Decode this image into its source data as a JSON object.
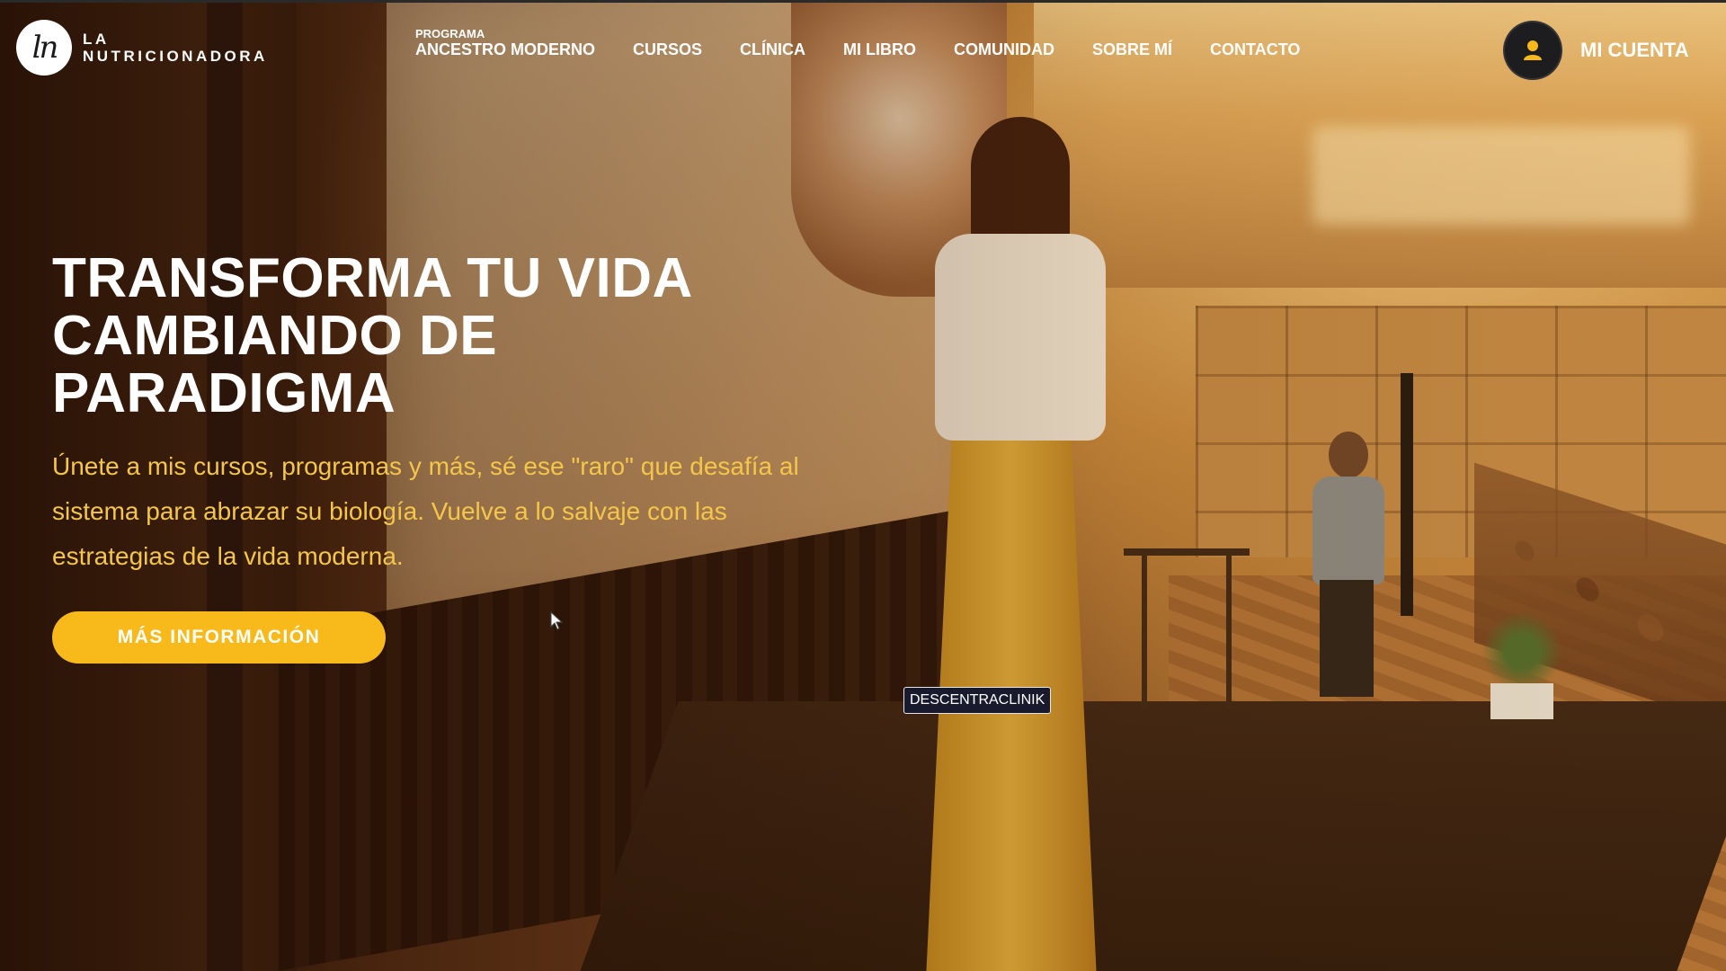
{
  "header": {
    "logo": {
      "line1": "LA",
      "line2": "NUTRICIONADORA",
      "mark": "ln"
    },
    "nav": [
      {
        "sup": "PROGRAMA",
        "label": "ANCESTRO MODERNO"
      },
      {
        "label": "CURSOS"
      },
      {
        "label": "CLÍNICA"
      },
      {
        "label": "MI LIBRO"
      },
      {
        "label": "COMUNIDAD"
      },
      {
        "label": "SOBRE MÍ"
      },
      {
        "label": "CONTACTO"
      }
    ],
    "account": {
      "label": "MI CUENTA",
      "icon": "user-icon"
    }
  },
  "hero": {
    "title_lines": [
      "TRANSFORMA TU VIDA",
      "CAMBIANDO DE",
      "PARADIGMA"
    ],
    "subtitle_lines": [
      "Únete a mis cursos, programas y más, sé ese \"raro\" que desafía al",
      "sistema para abrazar su biología. Vuelve a lo salvaje con las",
      "estrategias de la vida moderna."
    ],
    "cta_label": "MÁS INFORMACIÓN"
  },
  "tooltip": {
    "text": "DESCENTRACLINIK"
  },
  "colors": {
    "accent": "#f8b91a",
    "subtitle": "#f4c64a",
    "avatar_bg": "#1d1d1f",
    "avatar_icon": "#f8b91a"
  }
}
